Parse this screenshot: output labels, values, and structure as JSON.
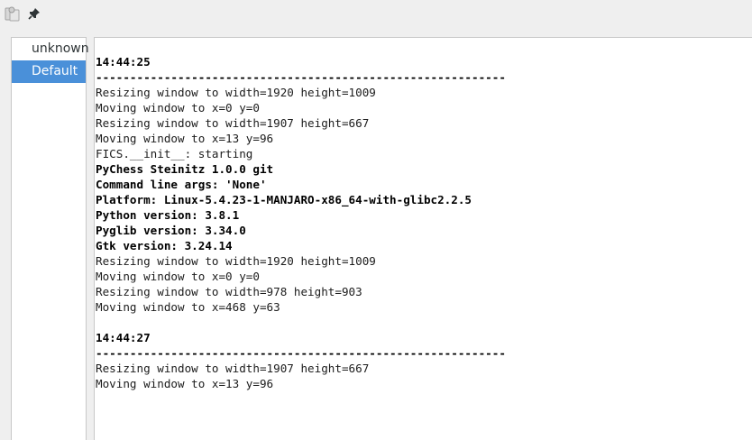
{
  "toolbar": {
    "icons": [
      "log-viewer-icon",
      "pin-icon"
    ]
  },
  "sidebar": {
    "items": [
      {
        "label": "unknown",
        "selected": false
      },
      {
        "label": "Default",
        "selected": true
      }
    ]
  },
  "log": {
    "lines": [
      {
        "text": "14:44:25",
        "bold": true
      },
      {
        "text": "------------------------------------------------------------",
        "bold": true
      },
      {
        "text": "Resizing window to width=1920 height=1009",
        "bold": false
      },
      {
        "text": "Moving window to x=0 y=0",
        "bold": false
      },
      {
        "text": "Resizing window to width=1907 height=667",
        "bold": false
      },
      {
        "text": "Moving window to x=13 y=96",
        "bold": false
      },
      {
        "text": "FICS.__init__: starting",
        "bold": false
      },
      {
        "text": "PyChess Steinitz 1.0.0 git",
        "bold": true
      },
      {
        "text": "Command line args: 'None'",
        "bold": true
      },
      {
        "text": "Platform: Linux-5.4.23-1-MANJARO-x86_64-with-glibc2.2.5",
        "bold": true
      },
      {
        "text": "Python version: 3.8.1",
        "bold": true
      },
      {
        "text": "Pyglib version: 3.34.0",
        "bold": true
      },
      {
        "text": "Gtk version: 3.24.14",
        "bold": true
      },
      {
        "text": "Resizing window to width=1920 height=1009",
        "bold": false
      },
      {
        "text": "Moving window to x=0 y=0",
        "bold": false
      },
      {
        "text": "Resizing window to width=978 height=903",
        "bold": false
      },
      {
        "text": "Moving window to x=468 y=63",
        "bold": false
      },
      {
        "text": "",
        "bold": false
      },
      {
        "text": "14:44:27",
        "bold": true
      },
      {
        "text": "------------------------------------------------------------",
        "bold": true
      },
      {
        "text": "Resizing window to width=1907 height=667",
        "bold": false
      },
      {
        "text": "Moving window to x=13 y=96",
        "bold": false
      }
    ]
  },
  "colors": {
    "selection": "#4a90d9",
    "background": "#efefef"
  }
}
